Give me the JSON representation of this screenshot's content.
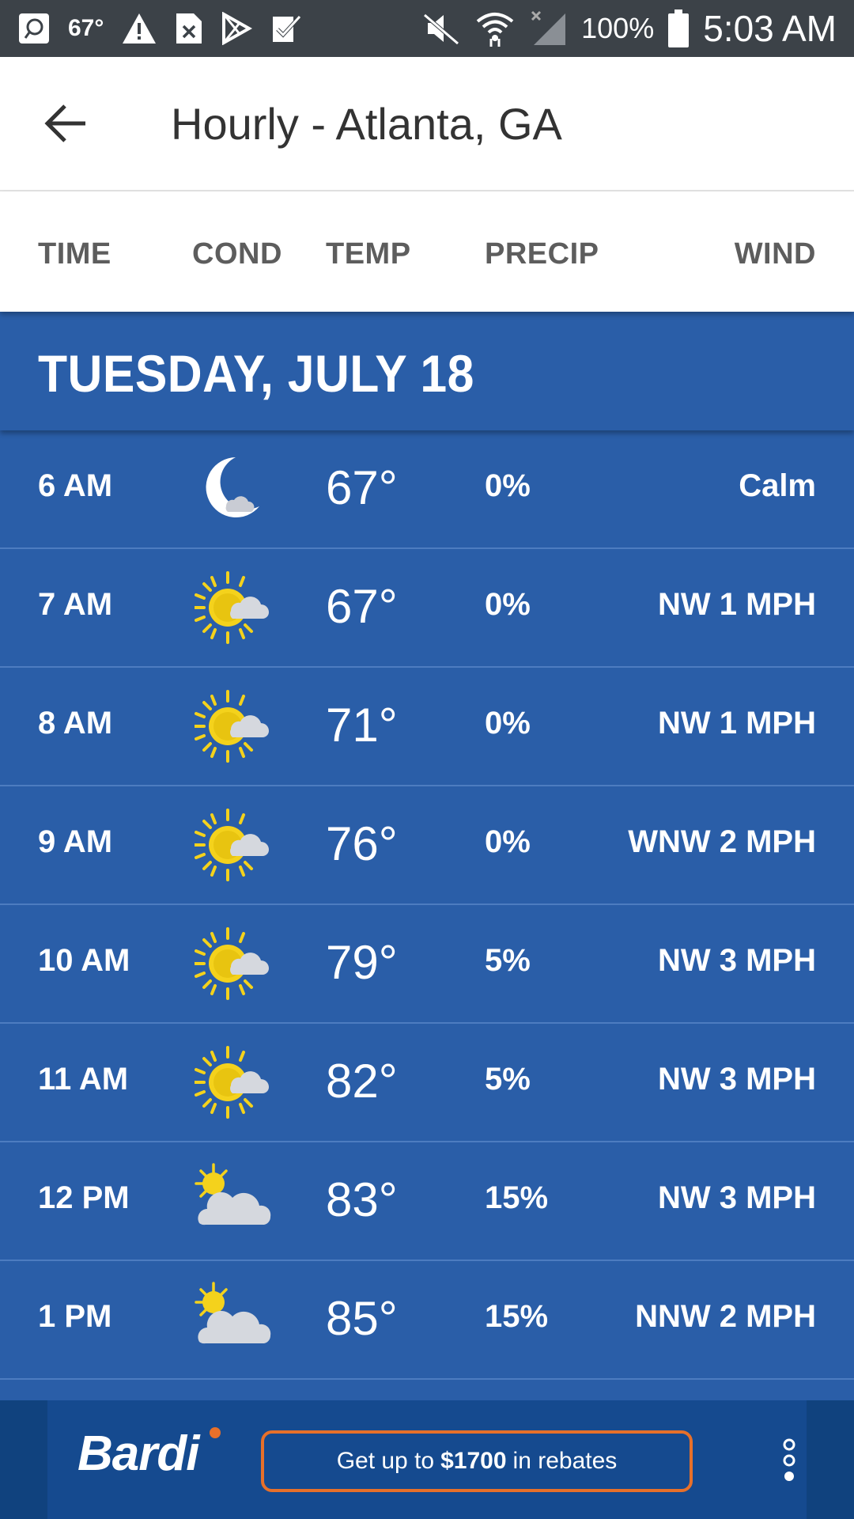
{
  "status_bar": {
    "temp": "67°",
    "battery": "100%",
    "time": "5:03 AM"
  },
  "app_bar": {
    "title": "Hourly - Atlanta, GA"
  },
  "columns": {
    "time": "TIME",
    "cond": "COND",
    "temp": "TEMP",
    "precip": "PRECIP",
    "wind": "WIND"
  },
  "day_header": "TUESDAY, JULY 18",
  "rows": [
    {
      "time": "6 AM",
      "icon": "moon-cloud-icon",
      "temp": "67°",
      "precip": "0%",
      "wind": "Calm"
    },
    {
      "time": "7 AM",
      "icon": "sun-cloud-icon",
      "temp": "67°",
      "precip": "0%",
      "wind": "NW 1 MPH"
    },
    {
      "time": "8 AM",
      "icon": "sun-cloud-icon",
      "temp": "71°",
      "precip": "0%",
      "wind": "NW 1 MPH"
    },
    {
      "time": "9 AM",
      "icon": "sun-cloud-icon",
      "temp": "76°",
      "precip": "0%",
      "wind": "WNW 2 MPH"
    },
    {
      "time": "10 AM",
      "icon": "sun-cloud-icon",
      "temp": "79°",
      "precip": "5%",
      "wind": "NW 3 MPH"
    },
    {
      "time": "11 AM",
      "icon": "sun-cloud-icon",
      "temp": "82°",
      "precip": "5%",
      "wind": "NW 3 MPH"
    },
    {
      "time": "12 PM",
      "icon": "partly-cloudy-icon",
      "temp": "83°",
      "precip": "15%",
      "wind": "NW 3 MPH"
    },
    {
      "time": "1 PM",
      "icon": "partly-cloudy-icon",
      "temp": "85°",
      "precip": "15%",
      "wind": "NNW 2 MPH"
    }
  ],
  "ad": {
    "brand": "Bardi",
    "cta_prefix": "Get up to",
    "cta_amount": "$1700",
    "cta_suffix": "in rebates"
  },
  "colors": {
    "row_bg": "#2a5ea8",
    "status_bar_bg": "#3c4248",
    "ad_accent": "#e7702a"
  }
}
